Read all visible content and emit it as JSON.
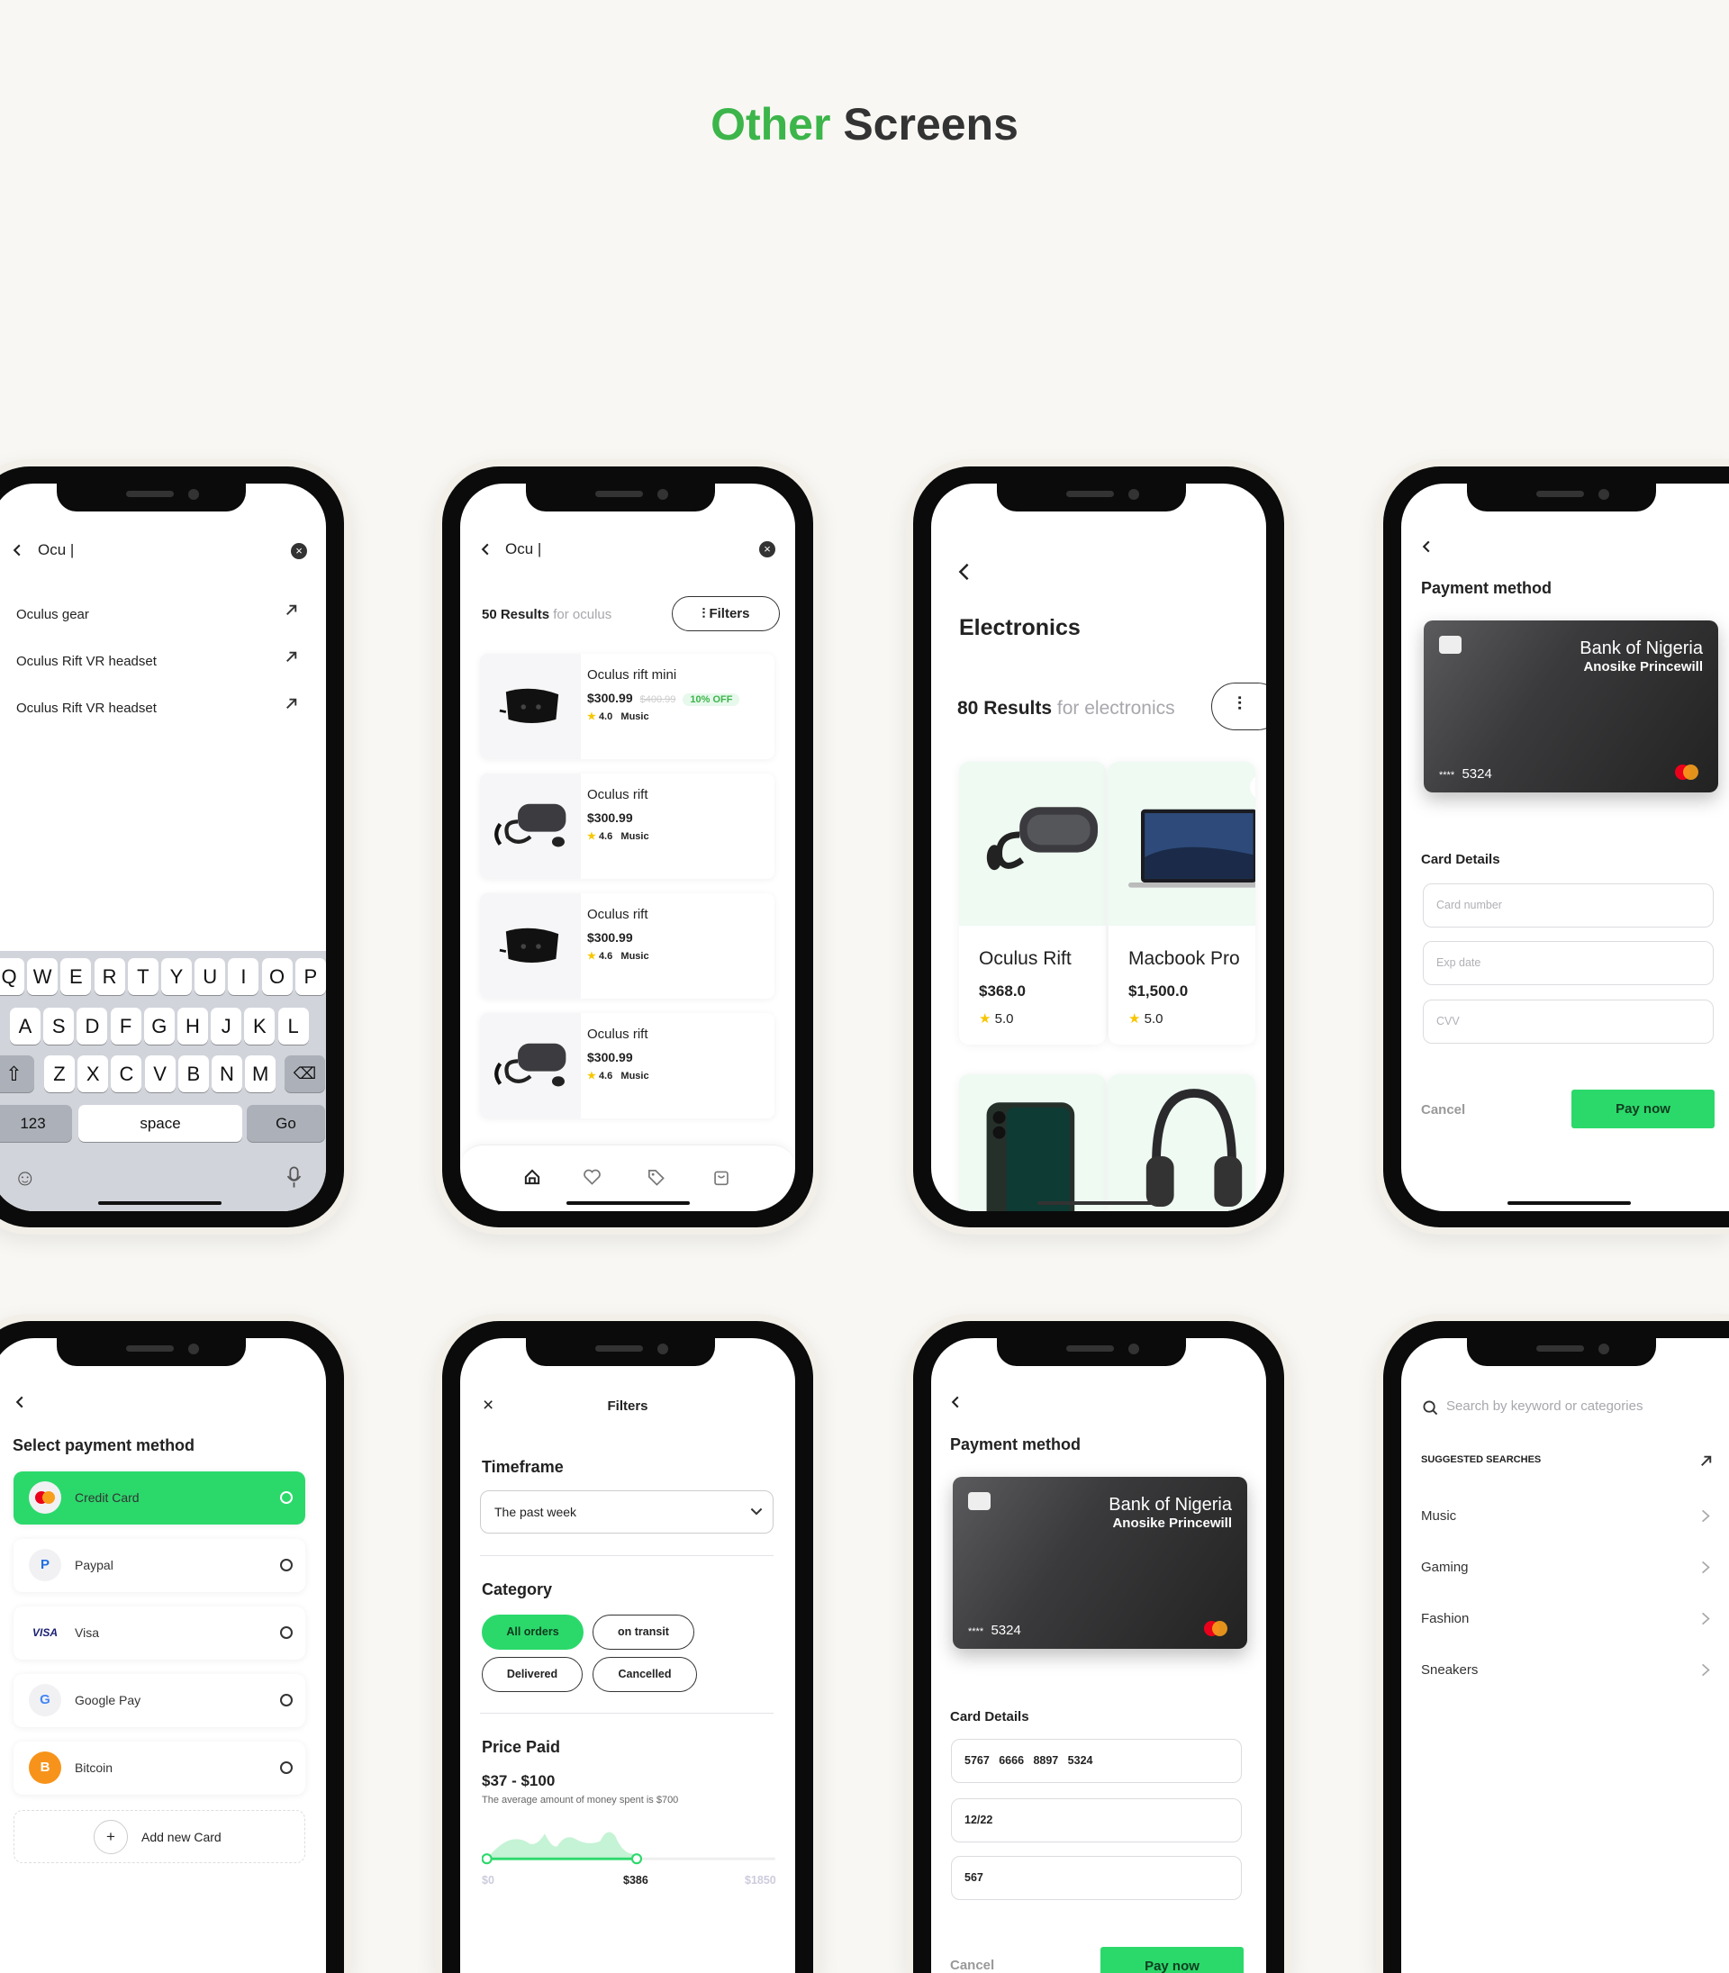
{
  "title": {
    "accent": "Other",
    "rest": " Screens"
  },
  "colors": {
    "accent": "#3cb54a",
    "button_green": "#2bd96b",
    "background": "#f8f7f3",
    "mint": "#eefaf2"
  },
  "search_suggest": {
    "query": "Ocu |",
    "suggestions": [
      "Oculus gear",
      "Oculus Rift VR headset",
      "Oculus Rift VR headset"
    ],
    "keyboard": {
      "row1": [
        "Q",
        "W",
        "E",
        "R",
        "T",
        "Y",
        "U",
        "I",
        "O",
        "P"
      ],
      "row2": [
        "A",
        "S",
        "D",
        "F",
        "G",
        "H",
        "J",
        "K",
        "L"
      ],
      "row3": [
        "Z",
        "X",
        "C",
        "V",
        "B",
        "N",
        "M"
      ],
      "numbers": "123",
      "space": "space",
      "go": "Go"
    }
  },
  "search_results": {
    "query": "Ocu |",
    "count": "50 Results",
    "for": " for oculus",
    "filters": "Filters",
    "products": [
      {
        "name": "Oculus rift mini",
        "price": "$300.99",
        "old_price": "$400.99",
        "badge": "10% OFF",
        "rating": "4.0",
        "category": "Music"
      },
      {
        "name": "Oculus rift",
        "price": "$300.99",
        "rating": "4.6",
        "category": "Music"
      },
      {
        "name": "Oculus rift",
        "price": "$300.99",
        "rating": "4.6",
        "category": "Music"
      },
      {
        "name": "Oculus rift",
        "price": "$300.99",
        "rating": "4.6",
        "category": "Music"
      }
    ],
    "nav": [
      "home-icon",
      "heart-icon",
      "tag-icon",
      "bag-icon"
    ]
  },
  "electronics": {
    "title": "Electronics",
    "count": "80 Results",
    "for": " for electronics",
    "products": [
      {
        "name": "Oculus Rift",
        "price": "$368.0",
        "rating": "5.0"
      },
      {
        "name": "Macbook Pro",
        "price": "$1,500.0",
        "rating": "5.0"
      }
    ]
  },
  "payment_empty": {
    "title": "Payment method",
    "card": {
      "bank": "Bank of  Nigeria",
      "holder": "Anosike Princewill",
      "mask": "****",
      "last4": "5324"
    },
    "details_label": "Card Details",
    "placeholders": {
      "number": "Card number",
      "exp": "Exp date",
      "cvv": "CVV"
    },
    "cancel": "Cancel",
    "pay": "Pay now"
  },
  "select_payment": {
    "title": "Select payment method",
    "methods": [
      {
        "label": "Credit Card",
        "icon": "MC",
        "selected": true
      },
      {
        "label": "Paypal",
        "icon": "P"
      },
      {
        "label": "Visa",
        "icon": "VISA"
      },
      {
        "label": "Google Pay",
        "icon": "G"
      },
      {
        "label": "Bitcoin",
        "icon": "B"
      }
    ],
    "add": "Add new Card"
  },
  "filters": {
    "title": "Filters",
    "timeframe_label": "Timeframe",
    "timeframe": "The past week",
    "category_label": "Category",
    "categories": [
      {
        "label": "All orders",
        "active": true
      },
      {
        "label": "on transit"
      },
      {
        "label": "Delivered"
      },
      {
        "label": "Cancelled"
      }
    ],
    "price_label": "Price Paid",
    "price_range": "$37 - $100",
    "price_note": "The average amount of money spent is $700",
    "slider": {
      "min": "$0",
      "value": "$386",
      "max": "$1850",
      "value_fraction": 0.21
    }
  },
  "payment_filled": {
    "title": "Payment method",
    "card": {
      "bank": "Bank of  Nigeria",
      "holder": "Anosike Princewill",
      "mask": "****",
      "last4": "5324"
    },
    "details_label": "Card Details",
    "values": {
      "number": "5767   6666   8897   5324",
      "exp": "12/22",
      "cvv": "567"
    },
    "cancel": "Cancel",
    "pay": "Pay now"
  },
  "categories_search": {
    "placeholder": "Search by keyword or categories",
    "suggested_label": "SUGGESTED SEARCHES",
    "items": [
      "Music",
      "Gaming",
      "Fashion",
      "Sneakers"
    ]
  }
}
